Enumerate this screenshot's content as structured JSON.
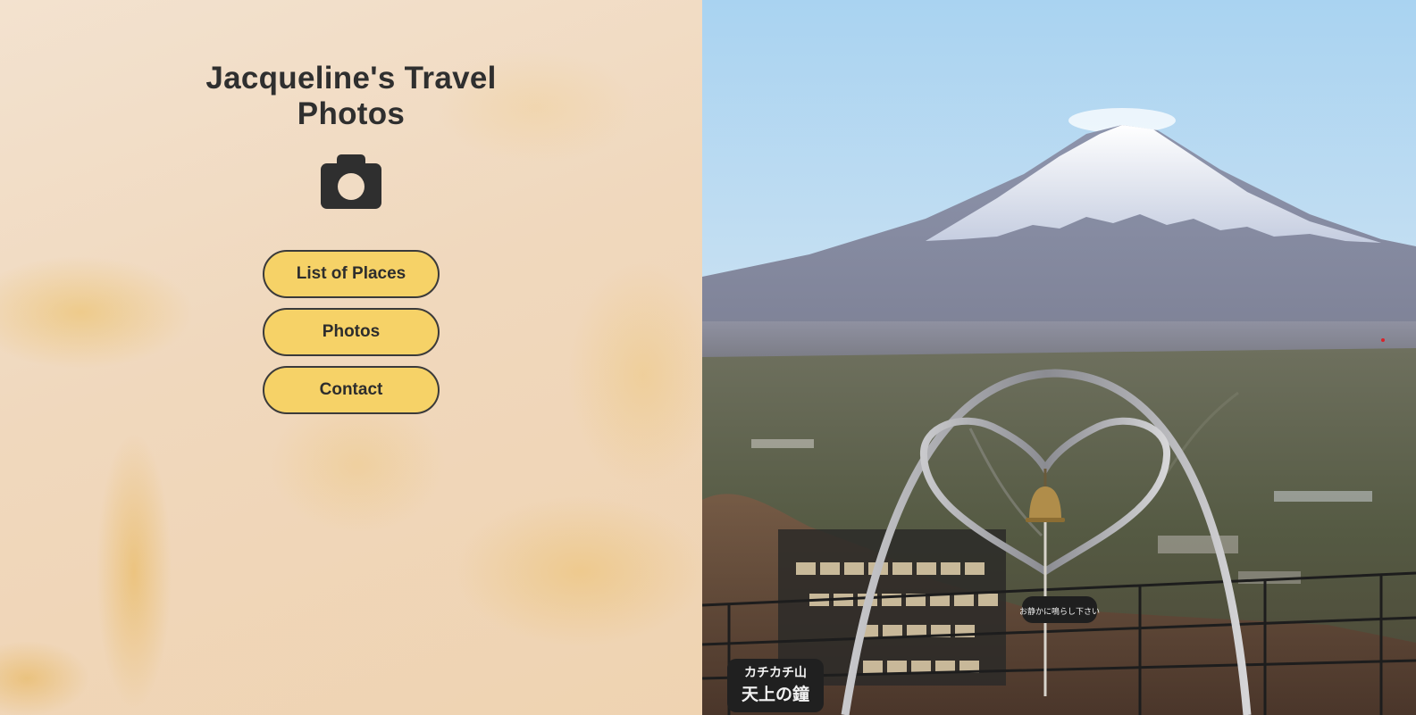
{
  "site": {
    "title": "Jacqueline's Travel Photos",
    "logo_icon": "camera-icon"
  },
  "nav": {
    "items": [
      {
        "label": "List of Places"
      },
      {
        "label": "Photos"
      },
      {
        "label": "Contact"
      }
    ]
  },
  "hero_photo": {
    "sign_line1": "カチカチ山",
    "sign_line2": "天上の鐘",
    "sign_small": "お静かに鳴らし下さい"
  },
  "colors": {
    "button_fill": "#f6d267",
    "button_border": "#3a3a3a",
    "title_text": "#2f2f2f",
    "panel_background": "#f1dcc4"
  }
}
